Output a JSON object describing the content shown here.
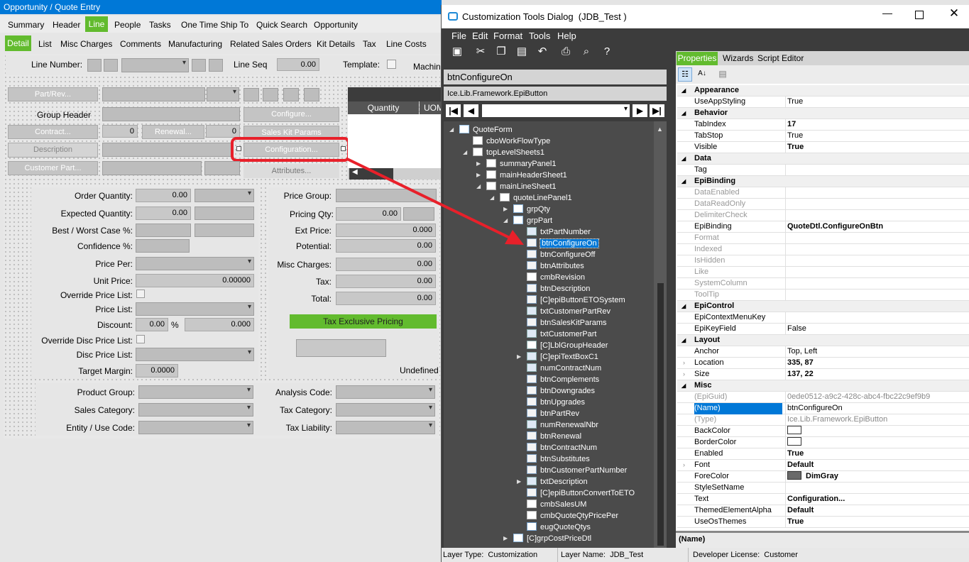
{
  "bg_window": {
    "title": "Opportunity / Quote Entry",
    "tabs1": [
      "Summary",
      "Header",
      "Line",
      "People",
      "Tasks",
      "One Time Ship To",
      "Quick Search",
      "Opportunity"
    ],
    "tabs2": [
      "Detail",
      "List",
      "Misc Charges",
      "Comments",
      "Manufacturing",
      "Related Sales Orders",
      "Kit Details",
      "Tax",
      "Line Costs"
    ],
    "line_number_label": "Line Number:",
    "line_seq_label": "Line Seq",
    "line_seq_value": "0.00",
    "template_label": "Template:",
    "machine_label": "Machin",
    "part_rev_btn": "Part/Rev...",
    "group_header_label": "Group Header",
    "configure_btn": "Configure...",
    "contract_btn": "Contract...",
    "contract_val": "0",
    "renewal_btn": "Renewal...",
    "renewal_val": "0",
    "sales_kit_btn": "Sales Kit Params",
    "description_btn": "Description",
    "configuration_btn": "Configuration...",
    "customer_part_btn": "Customer Part...",
    "attributes_btn": "Attributes...",
    "grid_headers": [
      "Quantity",
      "UOM"
    ],
    "left_labels": [
      "Order Quantity:",
      "Expected Quantity:",
      "Best / Worst Case %:",
      "Confidence %:",
      "Price Per:",
      "Unit Price:",
      "Override Price List:",
      "Price List:",
      "Discount:",
      "Override Disc Price List:",
      "Disc Price List:",
      "Target Margin:"
    ],
    "order_qty": "0.00",
    "expected_qty": "0.00",
    "unit_price": "0.00000",
    "discount_pct": "0.00",
    "discount_pct_sym": "%",
    "discount_amt": "0.000",
    "target_margin": "0.0000",
    "right_labels": [
      "Price Group:",
      "Pricing Qty:",
      "Ext Price:",
      "Potential:",
      "Misc Charges:",
      "Tax:",
      "Total:"
    ],
    "pricing_qty": "0.00",
    "ext_price": "0.000",
    "potential": "0.00",
    "misc_charges": "0.00",
    "tax": "0.00",
    "total": "0.00",
    "tax_exclusive_btn": "Tax Exclusive Pricing",
    "undefined_label": "Undefined",
    "bottom_left_labels": [
      "Product Group:",
      "Sales Category:",
      "Entity / Use Code:"
    ],
    "bottom_right_labels": [
      "Analysis Code:",
      "Tax Category:",
      "Tax Liability:"
    ]
  },
  "dialog": {
    "title": "Customization Tools Dialog  (JDB_Test )",
    "menu": [
      "File",
      "Edit",
      "Format",
      "Tools",
      "Help"
    ],
    "selected_control": "btnConfigureOn",
    "selected_type": "Ice.Lib.Framework.EpiButton",
    "tree": [
      {
        "label": "QuoteForm",
        "indent": 0,
        "icon": "form"
      },
      {
        "label": "cboWorkFlowType",
        "indent": 1,
        "icon": "combo"
      },
      {
        "label": "topLevelSheets1",
        "indent": 1,
        "icon": "sheet"
      },
      {
        "label": "summaryPanel1",
        "indent": 2,
        "icon": "sheet"
      },
      {
        "label": "mainHeaderSheet1",
        "indent": 2,
        "icon": "sheet"
      },
      {
        "label": "mainLineSheet1",
        "indent": 2,
        "icon": "sheet"
      },
      {
        "label": "quoteLinePanel1",
        "indent": 3,
        "icon": "sheet"
      },
      {
        "label": "grpQty",
        "indent": 4,
        "icon": "folder"
      },
      {
        "label": "grpPart",
        "indent": 4,
        "icon": "folder"
      },
      {
        "label": "txtPartNumber",
        "indent": 5,
        "icon": "text"
      },
      {
        "label": "btnConfigureOn",
        "indent": 5,
        "icon": "button",
        "selected": true
      },
      {
        "label": "btnConfigureOff",
        "indent": 5,
        "icon": "button"
      },
      {
        "label": "btnAttributes",
        "indent": 5,
        "icon": "button"
      },
      {
        "label": "cmbRevision",
        "indent": 5,
        "icon": "combo"
      },
      {
        "label": "btnDescription",
        "indent": 5,
        "icon": "button"
      },
      {
        "label": "[C]epiButtonETOSystem",
        "indent": 5,
        "icon": "button"
      },
      {
        "label": "txtCustomerPartRev",
        "indent": 5,
        "icon": "text"
      },
      {
        "label": "btnSalesKitParams",
        "indent": 5,
        "icon": "button"
      },
      {
        "label": "txtCustomerPart",
        "indent": 5,
        "icon": "text"
      },
      {
        "label": "[C]LblGroupHeader",
        "indent": 5,
        "icon": "label"
      },
      {
        "label": "[C]epiTextBoxC1",
        "indent": 5,
        "icon": "text"
      },
      {
        "label": "numContractNum",
        "indent": 5,
        "icon": "num"
      },
      {
        "label": "btnComplements",
        "indent": 5,
        "icon": "button"
      },
      {
        "label": "btnDowngrades",
        "indent": 5,
        "icon": "button"
      },
      {
        "label": "btnUpgrades",
        "indent": 5,
        "icon": "button"
      },
      {
        "label": "btnPartRev",
        "indent": 5,
        "icon": "button"
      },
      {
        "label": "numRenewalNbr",
        "indent": 5,
        "icon": "num"
      },
      {
        "label": "btnRenewal",
        "indent": 5,
        "icon": "button"
      },
      {
        "label": "btnContractNum",
        "indent": 5,
        "icon": "button"
      },
      {
        "label": "btnSubstitutes",
        "indent": 5,
        "icon": "button"
      },
      {
        "label": "btnCustomerPartNumber",
        "indent": 5,
        "icon": "button"
      },
      {
        "label": "txtDescription",
        "indent": 5,
        "icon": "text"
      },
      {
        "label": "[C]epiButtonConvertToETO",
        "indent": 5,
        "icon": "button"
      },
      {
        "label": "cmbSalesUM",
        "indent": 5,
        "icon": "combo"
      },
      {
        "label": "cmbQuoteQtyPricePer",
        "indent": 5,
        "icon": "combo"
      },
      {
        "label": "eugQuoteQtys",
        "indent": 5,
        "icon": "grid"
      },
      {
        "label": "[C]grpCostPriceDtl",
        "indent": 4,
        "icon": "folder"
      }
    ],
    "prop_tabs": [
      "Properties",
      "Wizards",
      "Script Editor"
    ],
    "properties": [
      {
        "cat": "Appearance"
      },
      {
        "k": "UseAppStyling",
        "v": "True"
      },
      {
        "cat": "Behavior"
      },
      {
        "k": "TabIndex",
        "v": "17",
        "b": true
      },
      {
        "k": "TabStop",
        "v": "True"
      },
      {
        "k": "Visible",
        "v": "True",
        "b": true
      },
      {
        "cat": "Data"
      },
      {
        "k": "Tag",
        "v": ""
      },
      {
        "cat": "EpiBinding"
      },
      {
        "k": "DataEnabled",
        "v": "",
        "g": true
      },
      {
        "k": "DataReadOnly",
        "v": "",
        "g": true
      },
      {
        "k": "DelimiterCheck",
        "v": "",
        "g": true
      },
      {
        "k": "EpiBinding",
        "v": "QuoteDtl.ConfigureOnBtn",
        "b": true
      },
      {
        "k": "Format",
        "v": "",
        "g": true
      },
      {
        "k": "Indexed",
        "v": "",
        "g": true
      },
      {
        "k": "IsHidden",
        "v": "",
        "g": true
      },
      {
        "k": "Like",
        "v": "",
        "g": true
      },
      {
        "k": "SystemColumn",
        "v": "",
        "g": true
      },
      {
        "k": "ToolTip",
        "v": "",
        "g": true
      },
      {
        "cat": "EpiControl"
      },
      {
        "k": "EpiContextMenuKey",
        "v": ""
      },
      {
        "k": "EpiKeyField",
        "v": "False"
      },
      {
        "cat": "Layout"
      },
      {
        "k": "Anchor",
        "v": "Top, Left"
      },
      {
        "k": "Location",
        "v": "335, 87",
        "b": true,
        "exp": true
      },
      {
        "k": "Size",
        "v": "137, 22",
        "b": true,
        "exp": true
      },
      {
        "cat": "Misc"
      },
      {
        "k": "(EpiGuid)",
        "v": "0ede0512-a9c2-428c-abc4-fbc22c9ef9b9",
        "g": true
      },
      {
        "k": "(Name)",
        "v": "btnConfigureOn",
        "sel": true
      },
      {
        "k": "(Type)",
        "v": "Ice.Lib.Framework.EpiButton",
        "g": true
      },
      {
        "k": "BackColor",
        "v": "",
        "sw": "#ffffff"
      },
      {
        "k": "BorderColor",
        "v": "",
        "sw": "#ffffff"
      },
      {
        "k": "Enabled",
        "v": "True",
        "b": true
      },
      {
        "k": "Font",
        "v": "Default",
        "b": true,
        "exp": true
      },
      {
        "k": "ForeColor",
        "v": "DimGray",
        "b": true,
        "sw": "#696969"
      },
      {
        "k": "StyleSetName",
        "v": ""
      },
      {
        "k": "Text",
        "v": "Configuration...",
        "b": true
      },
      {
        "k": "ThemedElementAlpha",
        "v": "Default",
        "b": true
      },
      {
        "k": "UseOsThemes",
        "v": "True",
        "b": true
      }
    ],
    "prop_desc": "(Name)",
    "status": {
      "layer_type": "Layer Type:  Customization",
      "layer_name": "Layer Name:  JDB_Test",
      "license": "Developer License:  Customer"
    }
  },
  "colors": {
    "accent_green": "#62bb2e",
    "dialog_dark": "#3c3c3c",
    "selection": "#0078d7",
    "highlight_red": "#e8202a"
  }
}
